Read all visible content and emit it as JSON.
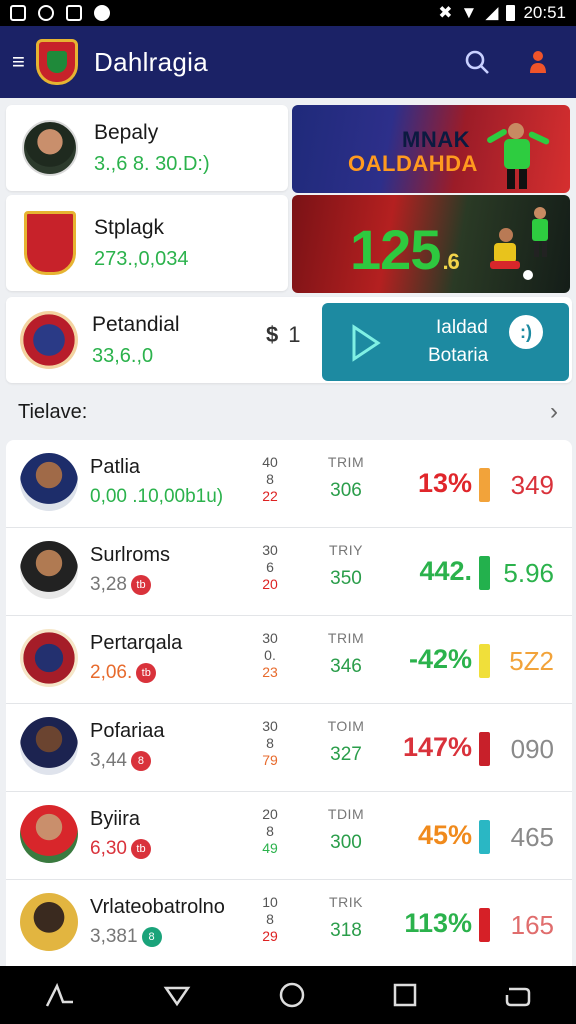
{
  "statusbar": {
    "time": "20:51"
  },
  "appbar": {
    "title": "Dahlragia"
  },
  "featured": [
    {
      "name": "Bepaly",
      "stat": "3.,6 8. 30.D:)",
      "stat_color": "#2bb24c"
    },
    {
      "name": "Stplagk",
      "stat": "273.,0,034",
      "stat_color": "#2bb24c"
    },
    {
      "name": "Petandial",
      "stat": "33,6.,0",
      "stat_color": "#2bb24c"
    }
  ],
  "promo1": {
    "line1": "MNAK",
    "line2": "OALDAHDA"
  },
  "promo2": {
    "big": "125",
    "suffix": ".6"
  },
  "mid_stat": {
    "a": "$",
    "b": "1"
  },
  "cta": {
    "line1": "Ialdad",
    "line2": "Botaria",
    "bubble": ":)"
  },
  "section": {
    "title": "Tielave:"
  },
  "rows": [
    {
      "name": "Patlia",
      "sub": "0,00 .10,00b1u)",
      "sub_color": "#2bb24c",
      "badge": "",
      "badge_color": "",
      "mini_top": "40",
      "mini_mid": "8",
      "mini_bot": "22",
      "mid_head": "TRIM",
      "mid_val": "306",
      "pct": "13%",
      "pct_color": "#e0262b",
      "bar_color": "#f2a33a",
      "val": "349",
      "val_color": "#d9323b"
    },
    {
      "name": "Surlroms",
      "sub": "3,28",
      "sub_color": "#777777",
      "badge": "tb",
      "badge_color": "#d9323b",
      "mini_top": "30",
      "mini_mid": "6",
      "mini_bot": "20",
      "mid_head": "TRIY",
      "mid_val": "350",
      "pct": "442.",
      "pct_color": "#2bb24c",
      "bar_color": "#23b14d",
      "val": "5.96",
      "val_color": "#2bb24c"
    },
    {
      "name": "Pertarqala",
      "sub": "2,06.",
      "sub_color": "#e76a2c",
      "badge": "tb",
      "badge_color": "#d9323b",
      "mini_top": "30",
      "mini_mid": "0.",
      "mini_bot": "23",
      "mid_head": "TRIM",
      "mid_val": "346",
      "pct": "-42%",
      "pct_color": "#2bb24c",
      "bar_color": "#f0df3a",
      "val": "5Z2",
      "val_color": "#f2a33a"
    },
    {
      "name": "Pofariaa",
      "sub": "3,44",
      "sub_color": "#777777",
      "badge": "8",
      "badge_color": "#d9323b",
      "mini_top": "30",
      "mini_mid": "8",
      "mini_bot": "79",
      "mid_head": "TOIM",
      "mid_val": "327",
      "pct": "147%",
      "pct_color": "#d9323b",
      "bar_color": "#c8202a",
      "val": "090",
      "val_color": "#8a8a8a"
    },
    {
      "name": "Byiira",
      "sub": "6,30",
      "sub_color": "#d9323b",
      "badge": "tb",
      "badge_color": "#d9323b",
      "mini_top": "20",
      "mini_mid": "8",
      "mini_bot": "49",
      "mid_head": "TDIM",
      "mid_val": "300",
      "pct": "45%",
      "pct_color": "#f08a1c",
      "bar_color": "#2ab7c4",
      "val": "465",
      "val_color": "#8a8a8a"
    },
    {
      "name": "Vrlateobatrolno",
      "sub": "3,381",
      "sub_color": "#777777",
      "badge": "8",
      "badge_color": "#1aa37a",
      "mini_top": "10",
      "mini_mid": "8",
      "mini_bot": "29",
      "mid_head": "TRIK",
      "mid_val": "318",
      "pct": "113%",
      "pct_color": "#2bb24c",
      "bar_color": "#d62027",
      "val": "165",
      "val_color": "#e06d6d"
    }
  ],
  "colors": {
    "appbar": "#1b2266",
    "cta": "#1d8aa1",
    "positive": "#2bb24c",
    "negative": "#e0262b"
  }
}
